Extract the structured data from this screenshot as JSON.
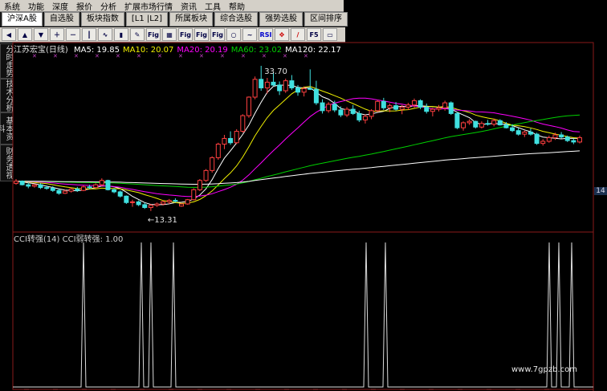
{
  "menu": [
    "系统",
    "功能",
    "深度",
    "报价",
    "分析",
    "扩展市场行情",
    "资讯",
    "工具",
    "帮助"
  ],
  "tabs": [
    "沪深A股",
    "自选股",
    "板块指数",
    "[L1 |L2]",
    "所属板块",
    "综合选股",
    "强势选股",
    "区间排序"
  ],
  "toolbar": {
    "fig_labels": [
      "Fig",
      "Fig",
      "Fig",
      "Fig"
    ],
    "rsi_label": "RSI",
    "f5_label": "F5",
    "icons": [
      "left-arrow-icon",
      "up-arrow-icon",
      "down-arrow-icon",
      "zoom-in-icon",
      "zoom-out-icon",
      "candlestick-icon",
      "line-chart-icon",
      "bar-chart-icon",
      "drawing-icon",
      "fig-icon",
      "grid-icon",
      "fig-icon",
      "fig-icon",
      "fig-icon",
      "circle-icon",
      "sine-icon",
      "rsi-icon",
      "move-icon",
      "pen-icon",
      "f5-icon",
      "window-icon"
    ]
  },
  "sidetabs": [
    "分时走势",
    "技术分析",
    "基本资料",
    "财务透视"
  ],
  "chart_data": [
    {
      "type": "candlestick",
      "title": "江苏宏宝(日线)",
      "ma": [
        {
          "name": "MA5",
          "value": "19.85",
          "color": "#ffffff"
        },
        {
          "name": "MA10",
          "value": "20.07",
          "color": "#f0f000"
        },
        {
          "name": "MA20",
          "value": "20.19",
          "color": "#ff00ff"
        },
        {
          "name": "MA60",
          "value": "23.02",
          "color": "#00d000"
        },
        {
          "name": "MA120",
          "value": "22.17",
          "color": "#ffffff"
        }
      ],
      "annotations": [
        {
          "text": "33.70"
        },
        {
          "text": "←13.31"
        }
      ],
      "price_axis_label": "14",
      "candles": [
        [
          17.2,
          17.8,
          17.0,
          17.5
        ],
        [
          17.5,
          17.6,
          16.9,
          17.0
        ],
        [
          17.0,
          17.3,
          16.5,
          16.8
        ],
        [
          16.8,
          17.1,
          16.6,
          17.0
        ],
        [
          17.0,
          17.2,
          16.4,
          16.6
        ],
        [
          16.6,
          16.9,
          16.3,
          16.5
        ],
        [
          16.5,
          16.8,
          16.0,
          16.2
        ],
        [
          16.2,
          16.4,
          15.6,
          15.8
        ],
        [
          15.8,
          16.3,
          15.7,
          16.1
        ],
        [
          16.1,
          16.6,
          15.9,
          16.4
        ],
        [
          16.4,
          16.7,
          16.0,
          16.2
        ],
        [
          16.2,
          16.9,
          16.1,
          16.7
        ],
        [
          16.7,
          17.0,
          16.4,
          16.6
        ],
        [
          16.6,
          17.2,
          16.5,
          17.0
        ],
        [
          17.0,
          17.9,
          16.8,
          17.6
        ],
        [
          17.6,
          17.7,
          16.2,
          16.3
        ],
        [
          16.3,
          16.5,
          15.8,
          16.0
        ],
        [
          16.0,
          16.2,
          15.2,
          15.4
        ],
        [
          15.4,
          15.5,
          14.3,
          14.5
        ],
        [
          14.5,
          14.9,
          13.9,
          14.6
        ],
        [
          14.6,
          14.8,
          14.0,
          14.2
        ],
        [
          14.2,
          14.5,
          13.6,
          13.8
        ],
        [
          13.8,
          14.3,
          13.31,
          14.1
        ],
        [
          14.1,
          14.5,
          13.9,
          14.3
        ],
        [
          14.3,
          14.8,
          14.1,
          14.6
        ],
        [
          14.6,
          15.0,
          14.3,
          14.8
        ],
        [
          14.8,
          15.1,
          14.5,
          14.7
        ],
        [
          14.0,
          14.4,
          13.9,
          14.3
        ],
        [
          14.3,
          15.0,
          14.2,
          14.9
        ],
        [
          14.9,
          16.5,
          14.8,
          16.3
        ],
        [
          16.3,
          17.8,
          16.1,
          17.6
        ],
        [
          17.6,
          19.2,
          17.4,
          19.0
        ],
        [
          19.0,
          21.0,
          18.7,
          20.8
        ],
        [
          20.8,
          22.9,
          20.5,
          22.7
        ],
        [
          22.7,
          24.0,
          22.0,
          23.5
        ],
        [
          23.5,
          24.5,
          22.6,
          22.9
        ],
        [
          22.9,
          24.8,
          22.7,
          24.5
        ],
        [
          24.5,
          26.9,
          24.3,
          26.7
        ],
        [
          26.7,
          29.4,
          26.4,
          29.3
        ],
        [
          29.3,
          32.2,
          29.0,
          31.8
        ],
        [
          31.8,
          33.7,
          30.2,
          30.6
        ],
        [
          30.6,
          32.0,
          29.8,
          31.4
        ],
        [
          31.4,
          32.8,
          30.8,
          31.0
        ],
        [
          31.0,
          31.5,
          29.6,
          30.2
        ],
        [
          30.2,
          31.9,
          29.9,
          31.6
        ],
        [
          31.6,
          32.4,
          30.3,
          30.6
        ],
        [
          30.6,
          31.0,
          29.5,
          30.0
        ],
        [
          30.0,
          30.8,
          29.4,
          30.5
        ],
        [
          30.5,
          33.2,
          30.3,
          30.4
        ],
        [
          30.4,
          31.6,
          28.2,
          28.5
        ],
        [
          28.5,
          29.0,
          27.0,
          27.4
        ],
        [
          27.4,
          28.6,
          27.1,
          28.3
        ],
        [
          28.3,
          28.8,
          27.2,
          27.5
        ],
        [
          27.5,
          28.0,
          26.5,
          26.8
        ],
        [
          26.8,
          27.9,
          26.5,
          27.6
        ],
        [
          27.6,
          28.2,
          26.8,
          27.0
        ],
        [
          27.0,
          27.4,
          25.8,
          26.1
        ],
        [
          26.1,
          26.9,
          25.6,
          26.6
        ],
        [
          26.6,
          27.6,
          26.2,
          27.4
        ],
        [
          27.4,
          28.9,
          27.2,
          28.7
        ],
        [
          28.7,
          29.2,
          27.5,
          27.8
        ],
        [
          27.8,
          28.4,
          27.2,
          28.1
        ],
        [
          28.1,
          28.6,
          27.4,
          27.6
        ],
        [
          27.6,
          28.2,
          26.9,
          27.9
        ],
        [
          27.9,
          28.5,
          27.5,
          28.2
        ],
        [
          28.2,
          29.1,
          27.8,
          28.8
        ],
        [
          28.8,
          29.0,
          27.6,
          27.9
        ],
        [
          27.9,
          28.4,
          27.0,
          27.3
        ],
        [
          27.3,
          27.8,
          26.6,
          27.6
        ],
        [
          27.6,
          28.2,
          27.3,
          27.8
        ],
        [
          27.8,
          28.8,
          27.4,
          28.5
        ],
        [
          28.5,
          28.7,
          26.8,
          27.0
        ],
        [
          27.0,
          27.2,
          24.8,
          25.0
        ],
        [
          25.0,
          25.9,
          24.6,
          25.7
        ],
        [
          25.7,
          26.2,
          25.4,
          25.9
        ],
        [
          25.9,
          26.0,
          24.9,
          25.1
        ],
        [
          25.1,
          25.9,
          24.9,
          25.6
        ],
        [
          25.6,
          26.1,
          25.3,
          25.5
        ],
        [
          25.5,
          26.3,
          25.2,
          26.0
        ],
        [
          26.0,
          26.2,
          25.3,
          25.4
        ],
        [
          25.4,
          25.8,
          24.9,
          25.0
        ],
        [
          25.0,
          25.5,
          24.4,
          24.6
        ],
        [
          24.6,
          25.0,
          23.9,
          24.1
        ],
        [
          24.1,
          24.6,
          23.7,
          24.4
        ],
        [
          24.4,
          24.9,
          23.9,
          24.1
        ],
        [
          24.1,
          24.3,
          22.6,
          22.8
        ],
        [
          22.8,
          23.4,
          22.5,
          23.1
        ],
        [
          23.1,
          23.9,
          22.9,
          23.6
        ],
        [
          23.6,
          24.3,
          23.3,
          24.0
        ],
        [
          24.0,
          24.4,
          23.5,
          23.7
        ],
        [
          23.7,
          23.9,
          23.0,
          23.2
        ],
        [
          23.2,
          23.5,
          22.7,
          23.0
        ],
        [
          23.0,
          23.9,
          22.8,
          23.6
        ]
      ],
      "ylim": [
        12.5,
        35.5
      ]
    },
    {
      "type": "line",
      "title": "CCI转强(14)",
      "series": [
        {
          "name": "CCI弱转强",
          "value": "1.00"
        }
      ],
      "ylim": [
        0,
        1
      ],
      "spikes": [
        22,
        40,
        43,
        50,
        110,
        116,
        167,
        170,
        174
      ]
    }
  ],
  "watermark": "www.7gpzb.com"
}
